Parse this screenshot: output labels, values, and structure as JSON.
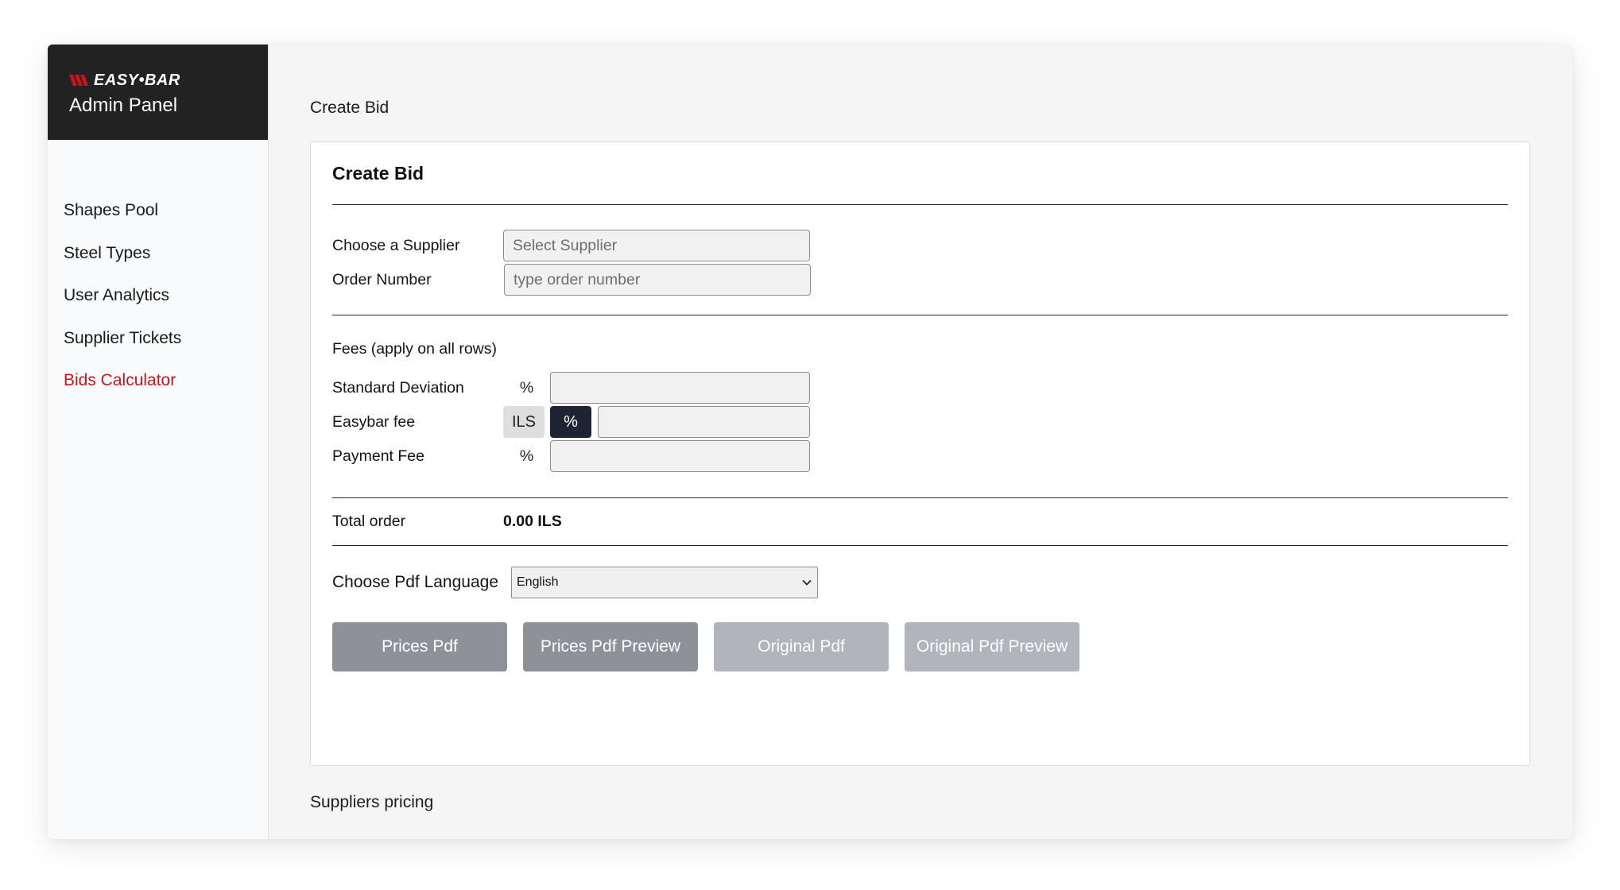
{
  "brand": {
    "logo_text": "EASY•BAR",
    "panel_title": "Admin Panel",
    "logo_color": "#c4161c"
  },
  "sidebar": {
    "items": [
      {
        "label": "Shapes Pool"
      },
      {
        "label": "Steel Types"
      },
      {
        "label": "User Analytics"
      },
      {
        "label": "Supplier Tickets"
      },
      {
        "label": "Bids Calculator",
        "active": true
      }
    ],
    "active_color": "#c4161c"
  },
  "main": {
    "breadcrumb": "Create Bid",
    "card_title": "Create Bid",
    "supplier": {
      "label": "Choose a Supplier",
      "placeholder": "Select Supplier",
      "value": ""
    },
    "order_number": {
      "label": "Order Number",
      "placeholder": "type order number",
      "value": ""
    },
    "fees": {
      "section_label": "Fees (apply on all rows)",
      "standard_deviation": {
        "label": "Standard Deviation",
        "unit": "%",
        "value": ""
      },
      "easybar_fee": {
        "label": "Easybar fee",
        "ils_label": "ILS",
        "pct_label": "%",
        "selected": "%",
        "value": ""
      },
      "payment_fee": {
        "label": "Payment Fee",
        "unit": "%",
        "value": ""
      }
    },
    "total": {
      "label": "Total order",
      "value": "0.00 ILS"
    },
    "pdf_language": {
      "label": "Choose Pdf Language",
      "selected": "English"
    },
    "buttons": {
      "prices_pdf": "Prices Pdf",
      "prices_pdf_preview": "Prices Pdf Preview",
      "original_pdf": "Original Pdf",
      "original_pdf_preview": "Original Pdf Preview"
    },
    "suppliers_pricing_label": "Suppliers pricing"
  }
}
